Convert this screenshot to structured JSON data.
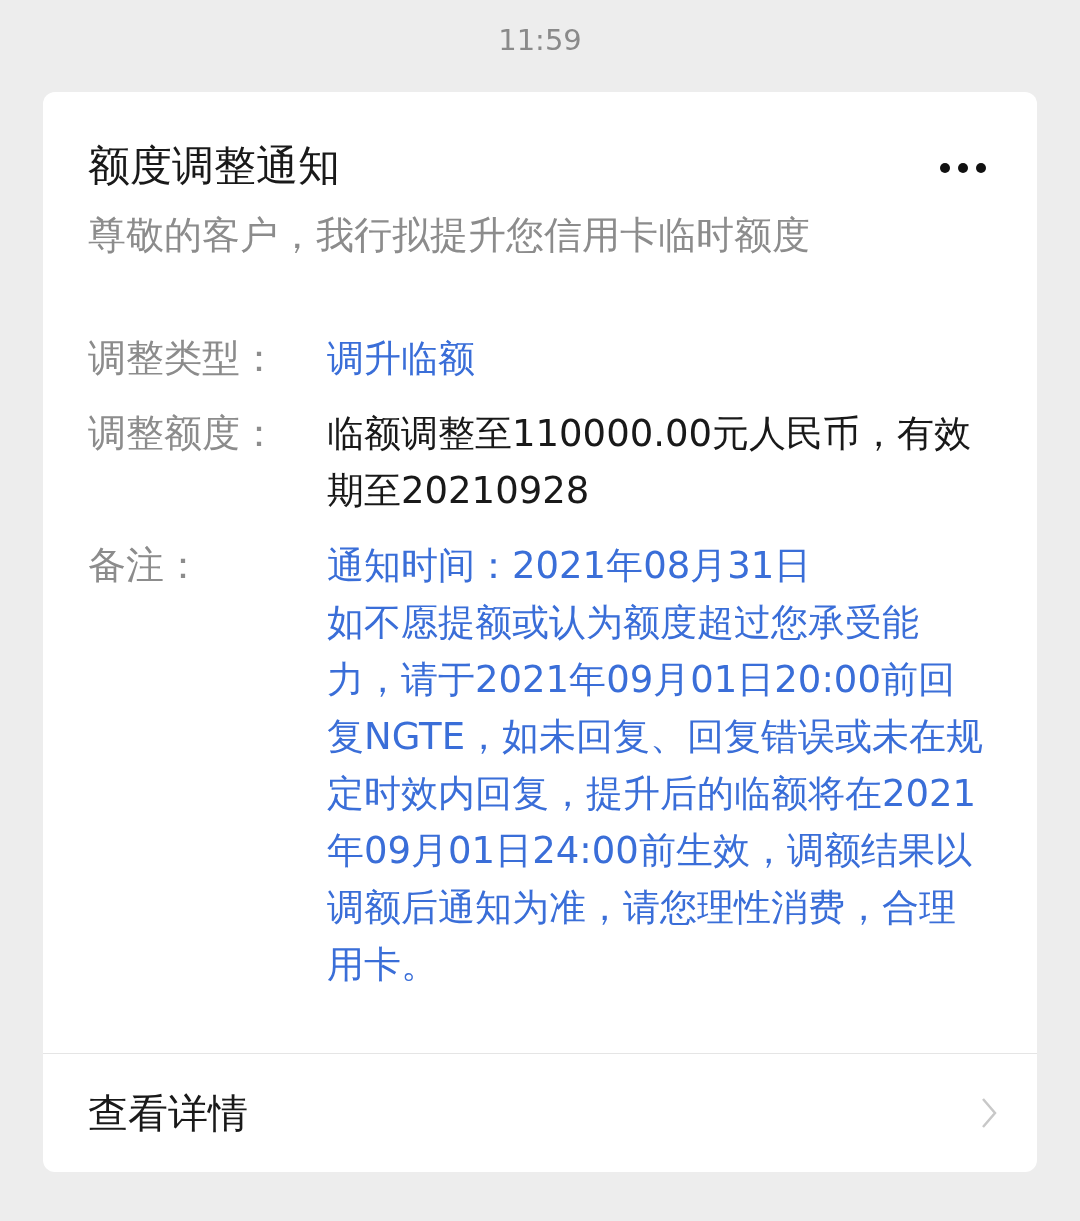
{
  "status_bar": {
    "time": "11:59"
  },
  "card": {
    "title": "额度调整通知",
    "subtitle": "尊敬的客户，我行拟提升您信用卡临时额度",
    "fields": [
      {
        "label": "调整类型：",
        "kind": "highlight",
        "paragraphs": [
          "调升临额"
        ]
      },
      {
        "label": "调整额度：",
        "kind": "plain",
        "paragraphs": [
          "临额调整至110000.00元人民币，有效期至20210928"
        ]
      },
      {
        "label": "备注：",
        "kind": "highlight",
        "paragraphs": [
          "通知时间：2021年08月31日",
          "如不愿提额或认为额度超过您承受能力，请于2021年09月01日20:00前回复NGTE，如未回复、回复错误或未在规定时效内回复，提升后的临额将在2021年09月01日24:00前生效，调额结果以调额后通知为准，请您理性消费，合理用卡。"
        ]
      }
    ],
    "footer": {
      "label": "查看详情"
    }
  }
}
